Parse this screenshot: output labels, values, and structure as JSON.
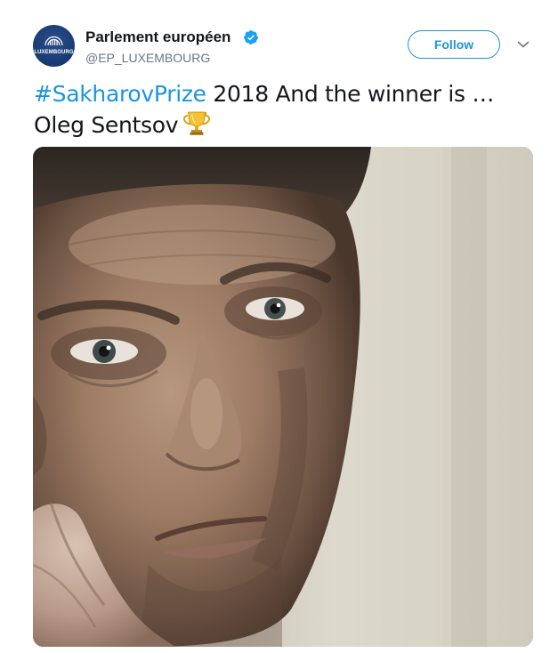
{
  "account": {
    "name": "Parlement européen",
    "handle": "@EP_LUXEMBOURG",
    "avatar_text": "LUXEMBOURG",
    "verified_icon": "verified-badge-icon",
    "verified_color": "#1da1f2"
  },
  "actions": {
    "follow_label": "Follow",
    "menu_icon": "chevron-down-icon"
  },
  "tweet": {
    "hashtag": "#SakharovPrize",
    "text_rest": " 2018 And the winner is …",
    "text_line2": "Oleg Sentsov",
    "emoji_icon": "trophy-icon"
  },
  "media": {
    "type": "photo",
    "icon": "portrait-photo"
  },
  "colors": {
    "accent": "#1b95e0",
    "text": "#14171a",
    "secondary": "#657786"
  }
}
